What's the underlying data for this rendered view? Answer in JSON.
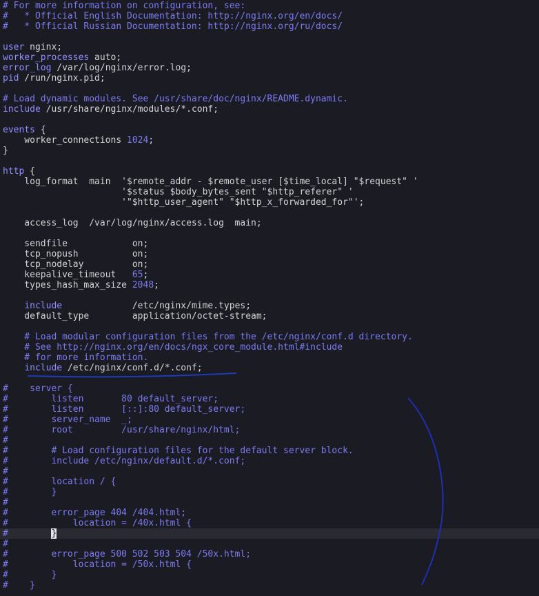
{
  "editor": {
    "lines": [
      "# For more information on configuration, see:",
      "#   * Official English Documentation: http://nginx.org/en/docs/",
      "#   * Official Russian Documentation: http://nginx.org/ru/docs/",
      "",
      "user nginx;",
      "worker_processes auto;",
      "error_log /var/log/nginx/error.log;",
      "pid /run/nginx.pid;",
      "",
      "# Load dynamic modules. See /usr/share/doc/nginx/README.dynamic.",
      "include /usr/share/nginx/modules/*.conf;",
      "",
      "events {",
      "    worker_connections 1024;",
      "}",
      "",
      "http {",
      "    log_format  main  '$remote_addr - $remote_user [$time_local] \"$request\" '",
      "                      '$status $body_bytes_sent \"$http_referer\" '",
      "                      '\"$http_user_agent\" \"$http_x_forwarded_for\"';",
      "",
      "    access_log  /var/log/nginx/access.log  main;",
      "",
      "    sendfile            on;",
      "    tcp_nopush          on;",
      "    tcp_nodelay         on;",
      "    keepalive_timeout   65;",
      "    types_hash_max_size 2048;",
      "",
      "    include             /etc/nginx/mime.types;",
      "    default_type        application/octet-stream;",
      "",
      "    # Load modular configuration files from the /etc/nginx/conf.d directory.",
      "    # See http://nginx.org/en/docs/ngx_core_module.html#include",
      "    # for more information.",
      "    include /etc/nginx/conf.d/*.conf;",
      "",
      "#    server {",
      "#        listen       80 default_server;",
      "#        listen       [::]:80 default_server;",
      "#        server_name  _;",
      "#        root         /usr/share/nginx/html;",
      "#",
      "#        # Load configuration files for the default server block.",
      "#        include /etc/nginx/default.d/*.conf;",
      "#",
      "#        location / {",
      "#        }",
      "#",
      "#        error_page 404 /404.html;",
      "#            location = /40x.html {",
      "#        }",
      "#",
      "#        error_page 500 502 503 504 /50x.html;",
      "#            location = /50x.html {",
      "#        }",
      "#    }"
    ],
    "cursor_line_index": 51
  }
}
